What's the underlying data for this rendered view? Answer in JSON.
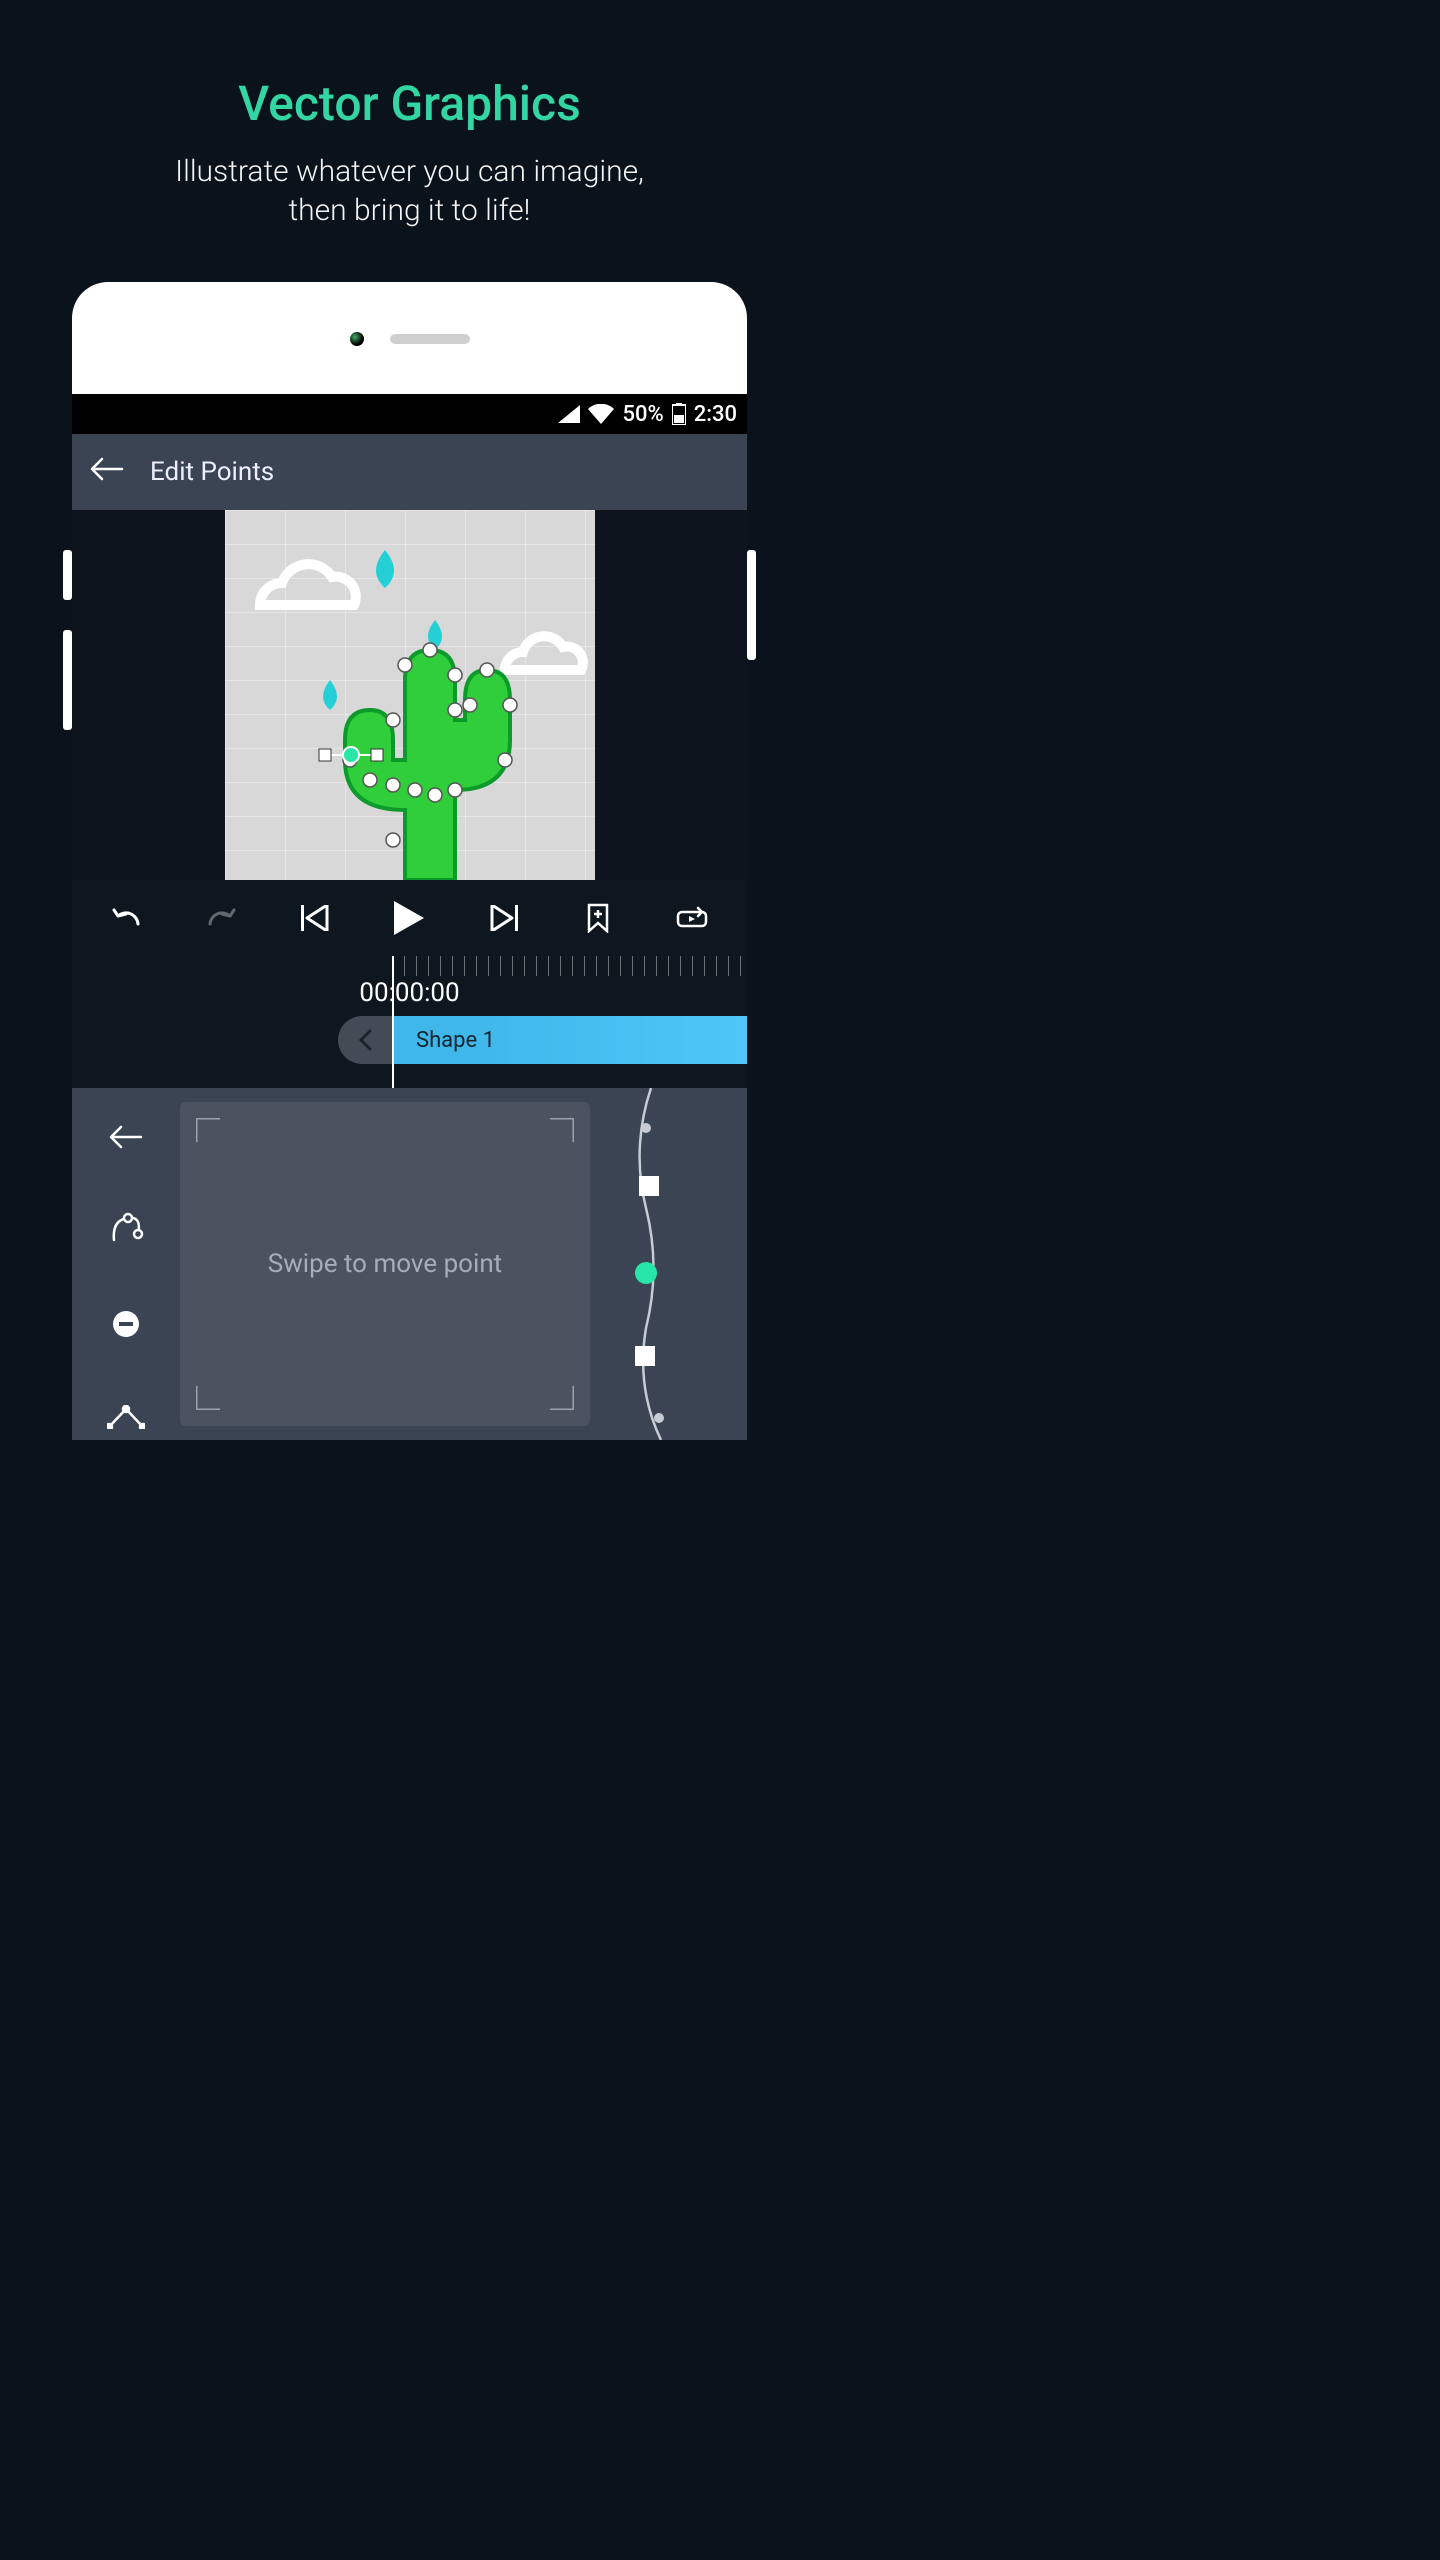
{
  "promo": {
    "title": "Vector Graphics",
    "subtitle": "Illustrate whatever you can imagine,\nthen bring it to life!"
  },
  "statusbar": {
    "battery_pct": "50%",
    "clock": "2:30"
  },
  "titlebar": {
    "label": "Edit Points"
  },
  "transport": {
    "undo": "undo",
    "redo": "redo",
    "prev_key": "prev-keyframe",
    "play": "play",
    "next_key": "next-keyframe",
    "add_bookmark": "add-bookmark",
    "loop": "loop"
  },
  "timeline": {
    "timecode": "00:00:00",
    "clip_label": "Shape 1"
  },
  "editor": {
    "pad_hint": "Swipe to move point",
    "tools": {
      "back": "back",
      "curve": "curve-path",
      "remove": "remove-point",
      "corner": "corner-point"
    }
  }
}
